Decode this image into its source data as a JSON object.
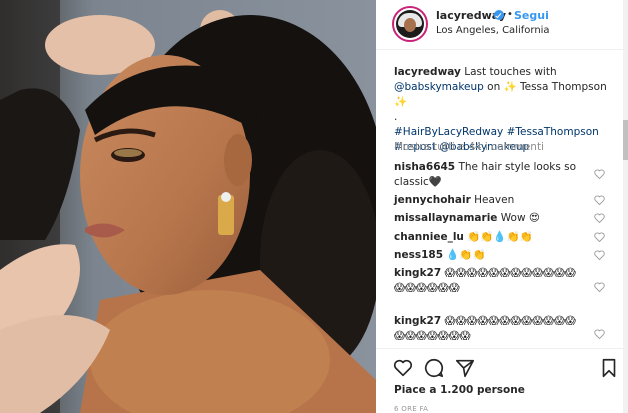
{
  "post": {
    "photo_alt": "",
    "colors": {
      "accent": "#3897f0",
      "hashtag_link": "#003569",
      "text": "#262626",
      "muted": "#8e8e8e"
    }
  },
  "header": {
    "username": "lacyredway",
    "verified_icon": "verified-badge-icon",
    "separator": "•",
    "follow_label": "Segui",
    "location": "Los Angeles, California"
  },
  "caption": {
    "username": "lacyredway",
    "text_1": "Last touches with",
    "mention_1": "@babskymakeup",
    "text_2": "on ✨ Tessa Thompson ✨",
    "text_3": ".",
    "hashtag_1": "#HairByLacyRedway",
    "hashtag_2": "#TessaThompson",
    "hashtag_3": "#repost",
    "mention_2": "@babskymakeup"
  },
  "view_more": "Mostra tutti e 44 i commenti",
  "comments": [
    {
      "user": "nisha6645",
      "text": "The hair style looks so classic🖤"
    },
    {
      "user": "jennychohair",
      "text": "Heaven"
    },
    {
      "user": "missallaynamarie",
      "text": "Wow 😍"
    },
    {
      "user": "channiee_lu",
      "text": "👏👏💧👏👏"
    },
    {
      "user": "ness185",
      "text": "💧👏👏"
    },
    {
      "user": "kingk27",
      "text": "😱😱😱😱😱😱😱😱😱😱😱😱😱😱😱😱😱😱"
    },
    {
      "user": "kingk27",
      "text": "😱😱😱😱😱😱😱😱😱😱😱😱😱😱😱😱😱😱😱"
    }
  ],
  "actions": {
    "like_icon": "heart-icon",
    "comment_icon": "comment-icon",
    "share_icon": "share-icon",
    "save_icon": "bookmark-icon",
    "likes_text": "Piace a 1.200 persone",
    "time_text": "6 ORE FA"
  }
}
